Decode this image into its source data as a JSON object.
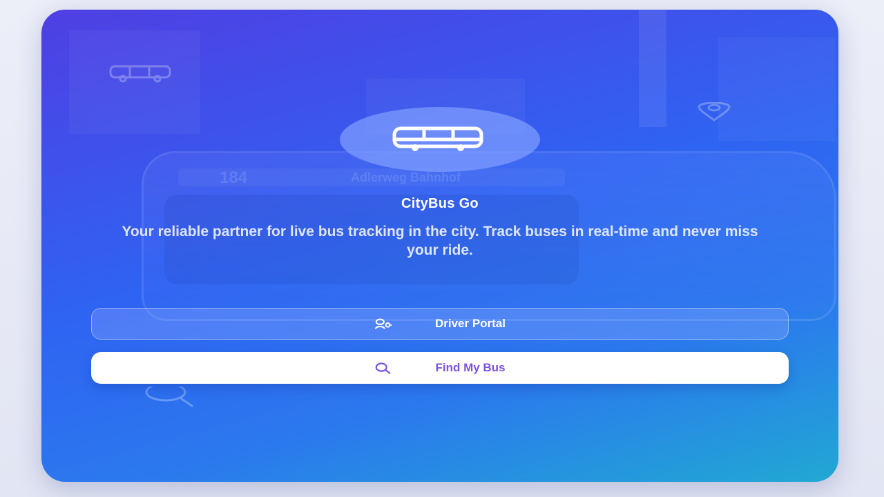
{
  "app": {
    "name": "CityBus Go",
    "tagline": "Your reliable partner for live bus tracking in the city. Track buses in real-time and never miss your ride."
  },
  "background": {
    "bus_sign_route": "184",
    "bus_sign_destination": "Adlerweg Bahnhof"
  },
  "buttons": {
    "driver_portal": {
      "label": "Driver Portal",
      "icon": "user-key-icon"
    },
    "find_my_bus": {
      "label": "Find My Bus",
      "icon": "search-icon"
    }
  },
  "icons": {
    "hero": "bus-icon",
    "deco_top_left": "bus-icon",
    "deco_top_right": "location-pin-icon",
    "deco_bottom_left": "search-icon"
  },
  "colors": {
    "gradient_start": "#4f3fe3",
    "gradient_mid": "#2f63f2",
    "gradient_end": "#21a8d3",
    "find_button_text": "#7b53e0",
    "white": "#ffffff"
  }
}
